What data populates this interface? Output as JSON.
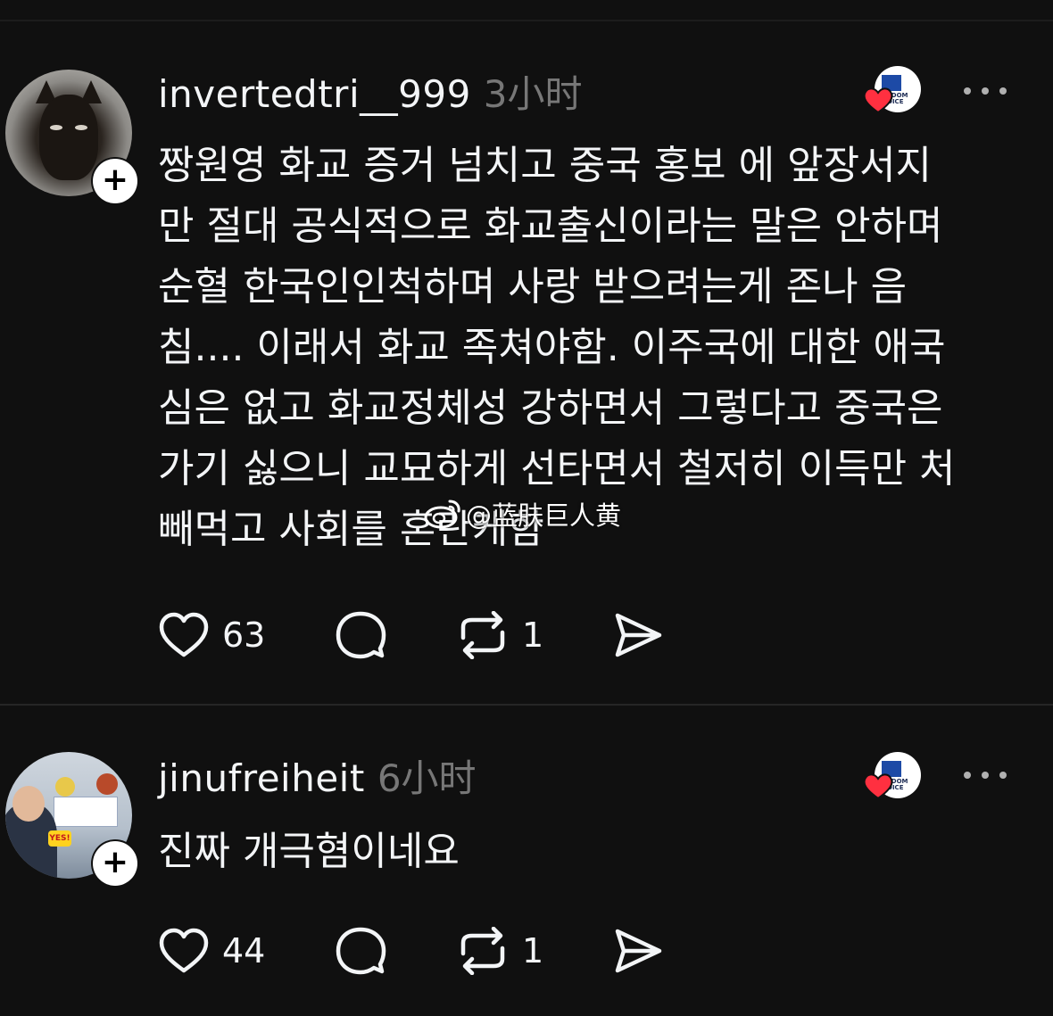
{
  "posts": [
    {
      "username": "invertedtri__999",
      "time": "3小时",
      "avatar_icon": "cat-avatar",
      "body": "짱원영 화교 증거 넘치고 중국 홍보 에 앞장서지\n만 절대 공식적으로 화교출신이라는 말은 안하며\n순혈 한국인인척하며 사랑 받으려는게 존나 음\n침.... 이래서 화교 족쳐야함. 이주국에 대한 애국\n심은 없고 화교정체성 강하면서 그렇다고 중국은\n가기 싫으니 교묘하게 선타면서 철저히 이득만 처\n빼먹고 사회를 혼란케함",
      "likes": "63",
      "replies": "",
      "reposts": "1",
      "shares": ""
    },
    {
      "username": "jinufreiheit",
      "time": "6小时",
      "avatar_icon": "person-avatar",
      "avatar_sticker": "YES!",
      "body": "진짜 개극혐이네요",
      "likes": "44",
      "replies": "",
      "reposts": "1",
      "shares": ""
    }
  ],
  "watermark": {
    "text": "@蓝肤巨人黄",
    "icon": "weibo-icon"
  },
  "colors": {
    "background": "#101010",
    "text": "#f3f5f7",
    "muted": "#777777",
    "heart": "#ff3040"
  }
}
